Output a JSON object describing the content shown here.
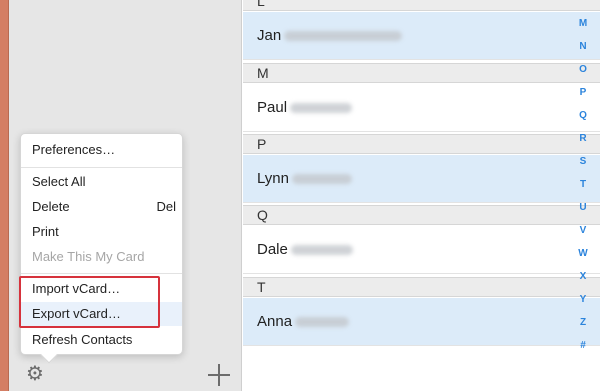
{
  "menu": {
    "items": [
      {
        "label": "Preferences…"
      },
      {
        "label": "Select All"
      },
      {
        "label": "Delete",
        "shortcut": "Del"
      },
      {
        "label": "Print"
      },
      {
        "label": "Make This My Card"
      },
      {
        "label": "Import vCard…"
      },
      {
        "label": "Export vCard…"
      },
      {
        "label": "Refresh Contacts"
      }
    ]
  },
  "toolbar": {
    "gear_icon": "gear-icon",
    "add_icon": "plus-icon"
  },
  "list": {
    "headers": [
      "L",
      "M",
      "P",
      "Q",
      "T"
    ],
    "contacts": [
      {
        "first": "Jan"
      },
      {
        "first": "Paul"
      },
      {
        "first": "Lynn"
      },
      {
        "first": "Dale"
      },
      {
        "first": "Anna"
      }
    ]
  },
  "index": {
    "letters": [
      "M",
      "N",
      "O",
      "P",
      "Q",
      "R",
      "S",
      "T",
      "U",
      "V",
      "W",
      "X",
      "Y",
      "Z",
      "#"
    ]
  },
  "colors": {
    "accent": "#2c84dc",
    "selection": "#dcebf9",
    "highlight_box": "#d6323c",
    "book_edge": "#d47e64"
  }
}
